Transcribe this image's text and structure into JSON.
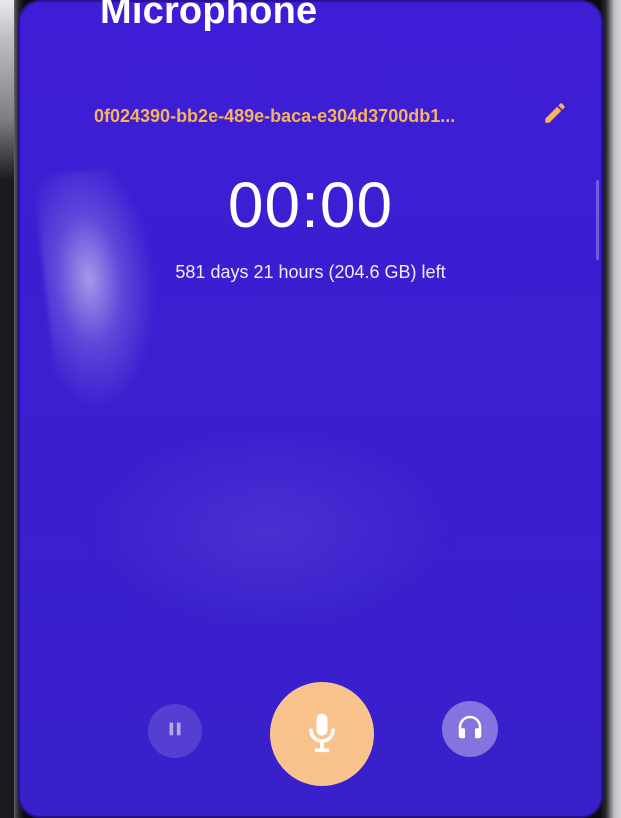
{
  "header": {
    "title": "Microphone"
  },
  "recording": {
    "file_name": "0f024390-bb2e-489e-baca-e304d3700db1...",
    "timer": "00:00",
    "remaining": "581 days 21 hours (204.6 GB) left"
  },
  "controls": {
    "pause_icon": "pause-icon",
    "record_icon": "microphone-icon",
    "monitor_icon": "headphones-icon"
  },
  "colors": {
    "screen_background": "#3f1dd6",
    "accent": "#f6b35e",
    "record_button": "#f7c28b"
  }
}
